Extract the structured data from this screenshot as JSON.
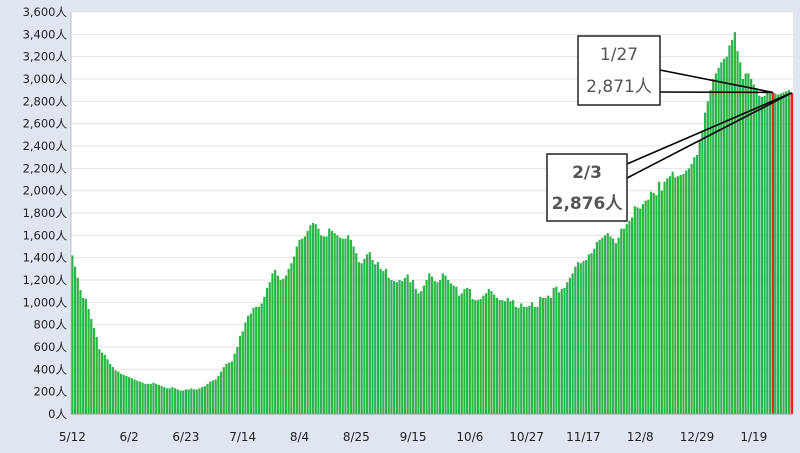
{
  "chart_data": {
    "type": "bar",
    "ylim": [
      0,
      3600
    ],
    "y_ticks": [
      "0人",
      "200人",
      "400人",
      "600人",
      "800人",
      "1,000人",
      "1,200人",
      "1,400人",
      "1,600人",
      "1,800人",
      "2,000人",
      "2,200人",
      "2,400人",
      "2,600人",
      "2,800人",
      "3,000人",
      "3,200人",
      "3,400人",
      "3,600人"
    ],
    "x_ticks": [
      "5/12",
      "6/2",
      "6/23",
      "7/14",
      "8/4",
      "8/25",
      "9/15",
      "10/6",
      "10/27",
      "11/17",
      "12/8",
      "12/29",
      "1/19"
    ],
    "x_start": "5/12",
    "x_end": "2/3",
    "colors": {
      "bar": "#2db34a",
      "highlight": "#e02a1f",
      "plot_bg": "#ffffff",
      "callout_line": "#000000"
    },
    "highlights": [
      {
        "date": "1/27",
        "value": 2871,
        "label_date": "1/27",
        "label_value": "2,871人"
      },
      {
        "date": "2/3",
        "value": 2876,
        "label_date": "2/3",
        "label_value": "2,876人"
      }
    ],
    "series": [
      {
        "values": [
          1420,
          1320,
          1220,
          1110,
          1040,
          1030,
          940,
          850,
          770,
          690,
          580,
          550,
          530,
          490,
          450,
          420,
          390,
          380,
          360,
          350,
          340,
          330,
          320,
          310,
          300,
          290,
          280,
          270,
          270,
          270,
          280,
          270,
          260,
          250,
          240,
          230,
          230,
          240,
          230,
          220,
          210,
          210,
          220,
          220,
          230,
          220,
          220,
          230,
          240,
          250,
          270,
          290,
          300,
          310,
          340,
          380,
          420,
          450,
          460,
          470,
          540,
          600,
          700,
          740,
          820,
          880,
          900,
          950,
          960,
          960,
          990,
          1050,
          1130,
          1180,
          1260,
          1290,
          1240,
          1200,
          1210,
          1240,
          1300,
          1350,
          1410,
          1500,
          1560,
          1570,
          1590,
          1640,
          1690,
          1710,
          1700,
          1660,
          1600,
          1590,
          1590,
          1660,
          1640,
          1620,
          1600,
          1580,
          1570,
          1570,
          1600,
          1560,
          1500,
          1440,
          1360,
          1350,
          1390,
          1430,
          1450,
          1380,
          1340,
          1360,
          1300,
          1280,
          1300,
          1220,
          1200,
          1190,
          1180,
          1200,
          1190,
          1220,
          1250,
          1180,
          1200,
          1120,
          1080,
          1100,
          1150,
          1200,
          1260,
          1230,
          1190,
          1180,
          1200,
          1260,
          1240,
          1200,
          1170,
          1150,
          1140,
          1060,
          1080,
          1120,
          1130,
          1120,
          1030,
          1020,
          1020,
          1030,
          1060,
          1080,
          1120,
          1100,
          1070,
          1040,
          1020,
          1020,
          1010,
          1040,
          1010,
          1020,
          960,
          950,
          990,
          960,
          960,
          970,
          1000,
          960,
          960,
          1050,
          1040,
          1040,
          1060,
          1040,
          1130,
          1140,
          1090,
          1120,
          1130,
          1180,
          1220,
          1260,
          1320,
          1360,
          1350,
          1370,
          1380,
          1430,
          1440,
          1480,
          1540,
          1560,
          1580,
          1600,
          1620,
          1590,
          1570,
          1530,
          1580,
          1660,
          1660,
          1700,
          1730,
          1760,
          1860,
          1850,
          1840,
          1880,
          1910,
          1920,
          1990,
          1980,
          1960,
          2080,
          2000,
          2080,
          2110,
          2130,
          2170,
          2120,
          2130,
          2140,
          2150,
          2180,
          2200,
          2240,
          2300,
          2320,
          2450,
          2540,
          2700,
          2800,
          2900,
          3000,
          3050,
          3100,
          3150,
          3180,
          3200,
          3300,
          3350,
          3420,
          3250,
          3150,
          3000,
          3050,
          3050,
          3000,
          2950,
          2920,
          2850,
          2840,
          2850,
          2880,
          2871,
          2880,
          2870,
          2860,
          2870,
          2880,
          2890,
          2900,
          2876
        ]
      }
    ]
  }
}
